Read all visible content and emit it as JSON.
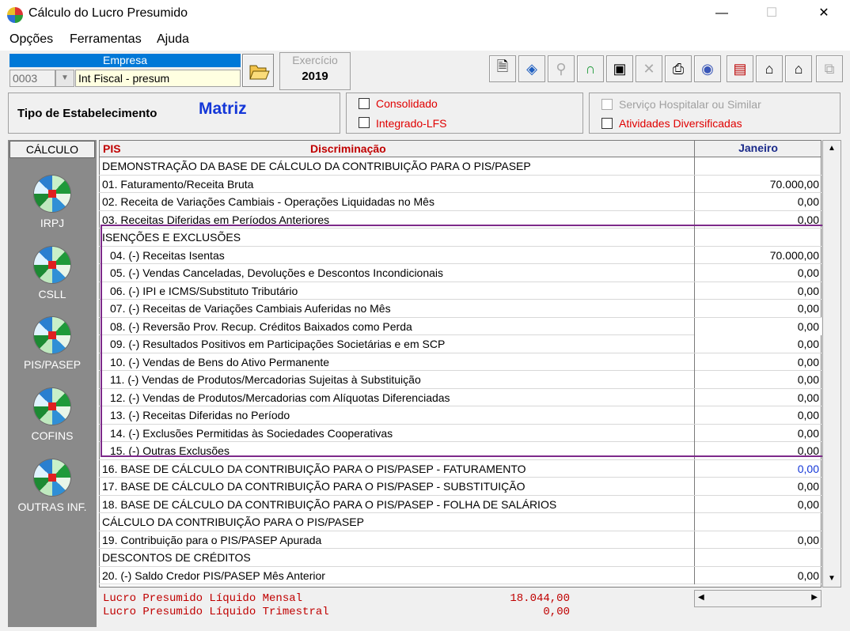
{
  "window": {
    "title": "Cálculo do Lucro Presumido",
    "minimize": "—",
    "maximize": "☐",
    "close": "✕"
  },
  "menu": {
    "opcoes": "Opções",
    "ferramentas": "Ferramentas",
    "ajuda": "Ajuda"
  },
  "empresa": {
    "label": "Empresa",
    "code": "0003",
    "name": "Int Fiscal - presum"
  },
  "exercicio": {
    "label": "Exercício",
    "value": "2019"
  },
  "toolbar": {
    "icons": [
      "document-icon",
      "navigate-icon",
      "search-icon",
      "lock-icon",
      "save-icon",
      "delete-icon",
      "print-icon",
      "disk-icon",
      "report-icon",
      "home-up-icon",
      "home-down-icon",
      "copy-icon"
    ]
  },
  "estabelecimento": {
    "label": "Tipo de Estabelecimento",
    "value": "Matriz"
  },
  "options": {
    "consolidado": "Consolidado",
    "integrado": "Integrado-LFS",
    "servico_hospitalar": "Serviço Hospitalar ou Similar",
    "atividades": "Atividades Diversificadas"
  },
  "colors": {
    "red": "#c00000",
    "blue": "#1437d8",
    "highlight": "#7d2a8a"
  },
  "sidebar": {
    "title": "CÁLCULO",
    "items": [
      "IRPJ",
      "CSLL",
      "PIS/PASEP",
      "COFINS",
      "OUTRAS INF."
    ]
  },
  "grid": {
    "col_pis": "PIS",
    "col_disc": "Discriminação",
    "col_month": "Janeiro",
    "rows": [
      {
        "label": "DEMONSTRAÇÃO DA BASE DE CÁLCULO DA CONTRIBUIÇÃO PARA O PIS/PASEP",
        "value": ""
      },
      {
        "label": "01. Faturamento/Receita Bruta",
        "value": "70.000,00"
      },
      {
        "label": "02. Receita de Variações Cambiais - Operações Liquidadas no Mês",
        "value": "0,00"
      },
      {
        "label": "03. Receitas Diferidas em Períodos Anteriores",
        "value": "0,00"
      },
      {
        "label": "ISENÇÕES E EXCLUSÕES",
        "value": ""
      },
      {
        "label": "04. (-) Receitas Isentas",
        "value": "70.000,00"
      },
      {
        "label": "05. (-) Vendas Canceladas, Devoluções e Descontos Incondicionais",
        "value": "0,00"
      },
      {
        "label": "06. (-) IPI e ICMS/Substituto Tributário",
        "value": "0,00"
      },
      {
        "label": "07. (-) Receitas de Variações Cambiais Auferidas no Mês",
        "value": "0,00"
      },
      {
        "label": "08. (-) Reversão Prov. Recup. Créditos Baixados como Perda",
        "value": "0,00"
      },
      {
        "label": "09. (-) Resultados Positivos em Participações Societárias e em SCP",
        "value": "0,00"
      },
      {
        "label": "10. (-) Vendas de Bens do Ativo Permanente",
        "value": "0,00"
      },
      {
        "label": "11. (-) Vendas de Produtos/Mercadorias Sujeitas à Substituição",
        "value": "0,00"
      },
      {
        "label": "12. (-) Vendas de Produtos/Mercadorias com Alíquotas Diferenciadas",
        "value": "0,00"
      },
      {
        "label": "13. (-) Receitas Diferidas no Período",
        "value": "0,00"
      },
      {
        "label": "14. (-) Exclusões Permitidas às Sociedades Cooperativas",
        "value": "0,00"
      },
      {
        "label": "15. (-) Outras Exclusões",
        "value": "0,00"
      },
      {
        "label": "16. BASE DE CÁLCULO DA CONTRIBUIÇÃO PARA O PIS/PASEP - FATURAMENTO",
        "value": "0,00"
      },
      {
        "label": "17. BASE DE CÁLCULO DA CONTRIBUIÇÃO PARA O PIS/PASEP - SUBSTITUIÇÃO",
        "value": "0,00"
      },
      {
        "label": "18. BASE DE CÁLCULO DA CONTRIBUIÇÃO PARA O PIS/PASEP - FOLHA DE SALÁRIOS",
        "value": "0,00"
      },
      {
        "label": "CÁLCULO DA CONTRIBUIÇÃO PARA O PIS/PASEP",
        "value": ""
      },
      {
        "label": "19. Contribuição para o PIS/PASEP Apurada",
        "value": "0,00"
      },
      {
        "label": "DESCONTOS DE CRÉDITOS",
        "value": ""
      },
      {
        "label": "20. (-) Saldo Credor PIS/PASEP Mês Anterior",
        "value": "0,00"
      }
    ]
  },
  "footer": {
    "mensal_label": "Lucro Presumido Líquido Mensal",
    "mensal_value": "18.044,00",
    "trimestral_label": "Lucro Presumido Líquido Trimestral",
    "trimestral_value": "0,00"
  }
}
